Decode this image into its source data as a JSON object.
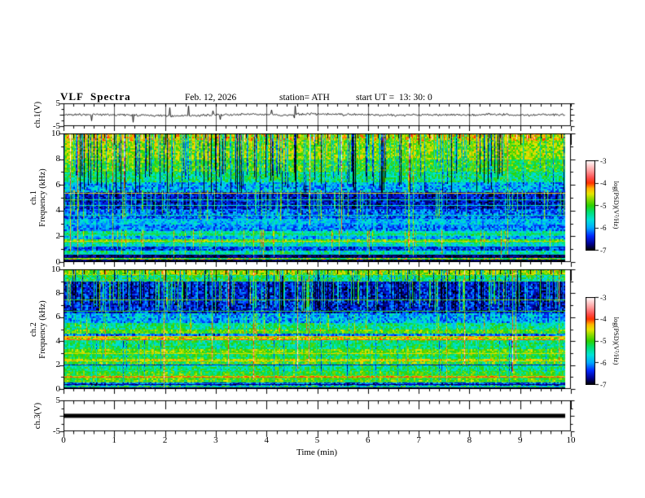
{
  "header": {
    "title": "VLF  Spectra",
    "date": "Feb. 12, 2026",
    "station": "station= ATH",
    "start_ut": "start UT =  13: 30: 0"
  },
  "x_axis": {
    "label": "Time  (min)",
    "unit": "min",
    "range": [
      0,
      10
    ],
    "major_ticks": [
      0,
      1,
      2,
      3,
      4,
      5,
      6,
      7,
      8,
      9,
      10
    ],
    "minor_ticks_per_major": 5,
    "data_end_min": 9.88
  },
  "colorbar": {
    "label": "log(PSD)(V²/Hz)",
    "ticks": [
      -3,
      -4,
      -5,
      -6,
      -7
    ],
    "range": [
      -7,
      -3
    ],
    "stops": [
      [
        0.0,
        "#000000"
      ],
      [
        0.07,
        "#00008c"
      ],
      [
        0.16,
        "#0028ff"
      ],
      [
        0.25,
        "#00aaff"
      ],
      [
        0.34,
        "#00e4d8"
      ],
      [
        0.43,
        "#00e070"
      ],
      [
        0.5,
        "#2ed200"
      ],
      [
        0.57,
        "#8cdc00"
      ],
      [
        0.63,
        "#e6e600"
      ],
      [
        0.69,
        "#ffb400"
      ],
      [
        0.75,
        "#ff3200"
      ],
      [
        0.81,
        "#ff5050"
      ],
      [
        0.88,
        "#ff9696"
      ],
      [
        0.95,
        "#ffd2d2"
      ],
      [
        1.0,
        "#ffffff"
      ]
    ]
  },
  "colors": {
    "background": "#ffffff",
    "frame": "#000000",
    "trace": "#000000",
    "gridline": "#5a5a5a"
  },
  "chart_data": [
    {
      "panel": "ch1_waveform",
      "type": "line",
      "ylabel": "ch.1(V)",
      "ylim": [
        -5,
        5
      ],
      "yticks": [
        5,
        -5
      ],
      "description": "broadband noise trace around 0 V with impulsive sferic spikes to about ±4.5 V, vertical gridlines each minute",
      "signal": {
        "baseline_v": 0,
        "noise_amp_v": 0.8,
        "spike_probability": 0.014,
        "spike_amp_v": [
          1.5,
          4.6
        ],
        "seed": 11
      }
    },
    {
      "panel": "ch1_spectrogram",
      "type": "heatmap",
      "ylabel_lines": [
        "ch.1",
        "Frequency (kHz)"
      ],
      "ylim_khz": [
        0,
        10
      ],
      "yticks": [
        10,
        8,
        6,
        4,
        2,
        0
      ],
      "value_range_log_psd": [
        -7,
        -3
      ],
      "bands": [
        [
          9.45,
          10.0,
          -4.5,
          0.5
        ],
        [
          8.0,
          9.45,
          -4.75,
          0.45
        ],
        [
          7.0,
          8.0,
          -5.0,
          0.45
        ],
        [
          6.2,
          7.0,
          -5.35,
          0.45
        ],
        [
          5.45,
          6.2,
          -5.95,
          0.5
        ],
        [
          4.1,
          5.45,
          -6.55,
          0.4
        ],
        [
          3.35,
          4.1,
          -6.2,
          0.45
        ],
        [
          2.9,
          3.35,
          -5.85,
          0.4
        ],
        [
          2.4,
          2.9,
          -6.1,
          0.4
        ],
        [
          2.05,
          2.4,
          -5.5,
          0.4
        ],
        [
          1.78,
          2.05,
          -5.95,
          0.4
        ],
        [
          1.5,
          1.78,
          -5.05,
          0.5
        ],
        [
          1.2,
          1.5,
          -5.6,
          0.4
        ],
        [
          0.9,
          1.2,
          -6.35,
          0.4
        ],
        [
          0.55,
          0.9,
          -5.55,
          0.5
        ],
        [
          0.33,
          0.55,
          -6.8,
          0.25
        ],
        [
          0.17,
          0.33,
          -4.9,
          0.8
        ],
        [
          0.0,
          0.17,
          -6.9,
          0.15
        ]
      ],
      "hlines": [
        [
          5.35,
          -4.5
        ],
        [
          4.85,
          -5.45
        ],
        [
          4.45,
          -5.55
        ],
        [
          3.7,
          -5.5
        ],
        [
          2.2,
          -5.15
        ],
        [
          1.62,
          -4.6
        ]
      ],
      "streaks": [
        {
          "prob": 0.17,
          "dv": -1.5,
          "f": [
            5.2,
            10
          ]
        },
        {
          "prob": 0.1,
          "dv": -0.8,
          "f": [
            6.5,
            10
          ]
        },
        {
          "prob": 0.13,
          "dv": 1.0,
          "f": [
            3.2,
            5.6
          ]
        },
        {
          "prob": 0.05,
          "dv": 0.9,
          "f": [
            0.3,
            2.5
          ]
        },
        {
          "prob": 0.018,
          "dv": 1.4,
          "f": [
            0,
            10
          ]
        },
        {
          "prob": 0.025,
          "dv": 1.2,
          "f": [
            9.3,
            10
          ]
        }
      ],
      "seed": 23
    },
    {
      "panel": "ch2_spectrogram",
      "type": "heatmap",
      "ylabel_lines": [
        "ch.2",
        "Frequency (kHz)"
      ],
      "ylim_khz": [
        0,
        10
      ],
      "yticks": [
        10,
        8,
        6,
        4,
        2,
        0
      ],
      "value_range_log_psd": [
        -7,
        -3
      ],
      "bands": [
        [
          9.55,
          10.0,
          -4.7,
          0.45
        ],
        [
          9.0,
          9.55,
          -5.25,
          0.5
        ],
        [
          6.3,
          9.0,
          -6.5,
          0.45
        ],
        [
          5.5,
          6.3,
          -5.95,
          0.5
        ],
        [
          4.95,
          5.5,
          -5.4,
          0.45
        ],
        [
          4.6,
          4.95,
          -4.95,
          0.4
        ],
        [
          4.32,
          4.6,
          -6.1,
          0.6
        ],
        [
          4.05,
          4.32,
          -4.6,
          0.5
        ],
        [
          3.35,
          4.05,
          -5.3,
          0.45
        ],
        [
          2.95,
          3.35,
          -4.85,
          0.4
        ],
        [
          2.5,
          2.95,
          -5.15,
          0.4
        ],
        [
          2.28,
          2.5,
          -4.6,
          0.4
        ],
        [
          1.95,
          2.28,
          -5.0,
          0.55
        ],
        [
          1.5,
          1.95,
          -5.35,
          0.45
        ],
        [
          1.12,
          1.5,
          -5.05,
          0.4
        ],
        [
          0.92,
          1.12,
          -4.4,
          0.5
        ],
        [
          0.55,
          0.92,
          -4.95,
          0.4
        ],
        [
          0.3,
          0.55,
          -6.2,
          0.55
        ],
        [
          0.12,
          0.3,
          -5.4,
          0.7
        ],
        [
          0.0,
          0.12,
          -6.85,
          0.15
        ]
      ],
      "hlines": [
        [
          7.5,
          -5.0
        ],
        [
          6.55,
          -5.1
        ],
        [
          4.45,
          -4.3
        ],
        [
          4.18,
          -4.05
        ],
        [
          2.98,
          -4.5
        ],
        [
          2.38,
          -4.35
        ],
        [
          2.02,
          -6.5
        ],
        [
          1.02,
          -4.0
        ],
        [
          0.42,
          -6.8
        ]
      ],
      "streaks": [
        {
          "prob": 0.2,
          "dv": 1.15,
          "f": [
            6.3,
            9.05
          ]
        },
        {
          "prob": 0.12,
          "dv": -1.0,
          "f": [
            6.3,
            10
          ]
        },
        {
          "prob": 0.05,
          "dv": 0.8,
          "f": [
            4.3,
            6.3
          ]
        },
        {
          "prob": 0.02,
          "dv": 1.4,
          "f": [
            0,
            10
          ]
        },
        {
          "prob": 0.06,
          "dv": -0.7,
          "f": [
            0,
            4.05
          ]
        }
      ],
      "seed": 37
    },
    {
      "panel": "ch3_waveform",
      "type": "line",
      "ylabel": "ch.3(V)",
      "ylim": [
        -5,
        5
      ],
      "yticks": [
        5,
        -5
      ],
      "description": "flat thick black line at 0 V (channel inactive)",
      "signal": {
        "baseline_v": 0,
        "flat": true,
        "line_thickness_px": 5,
        "seed": 3
      }
    }
  ]
}
